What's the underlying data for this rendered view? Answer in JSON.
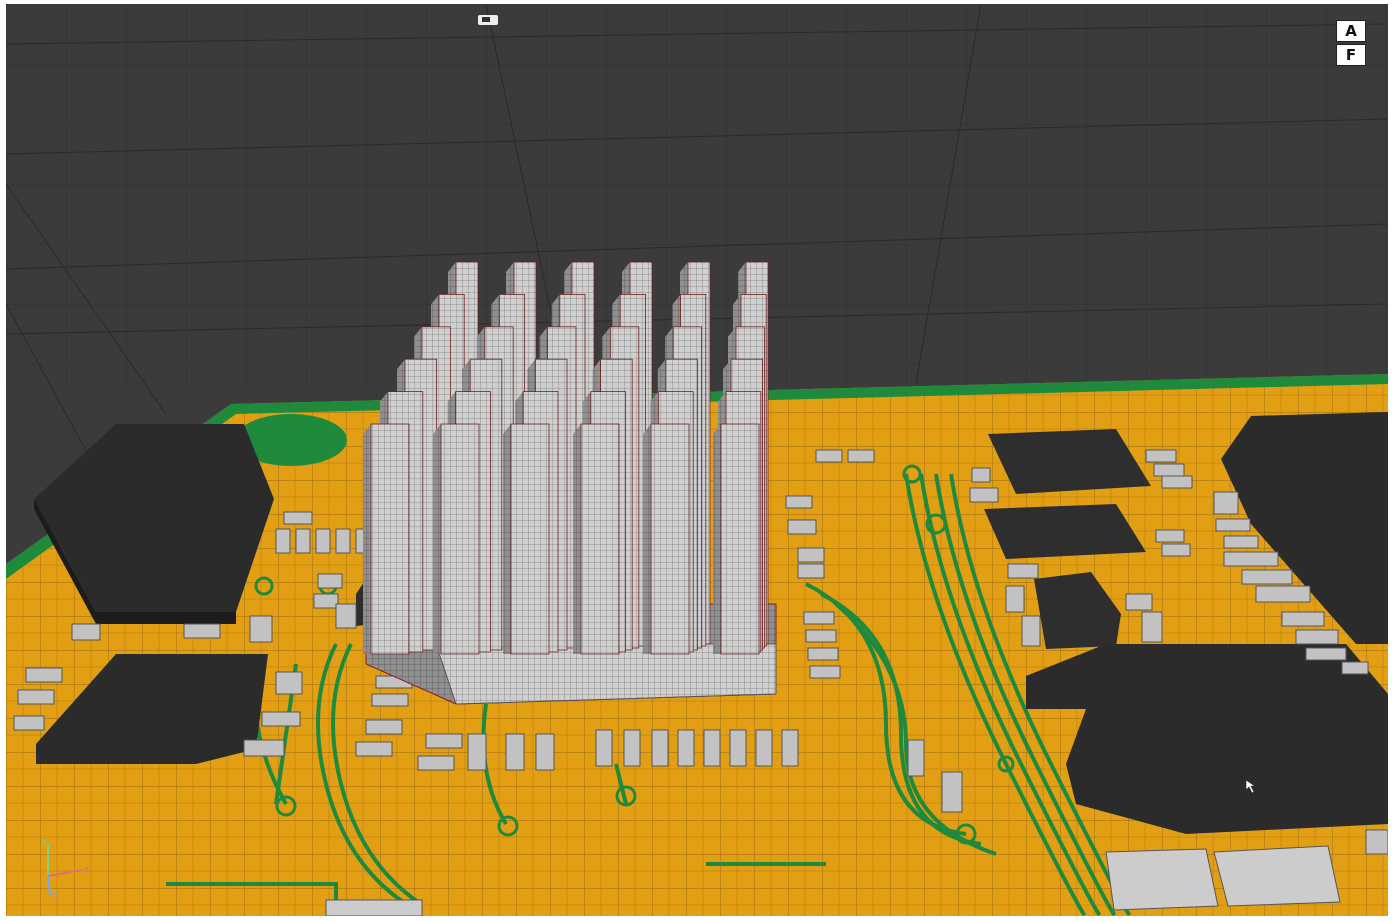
{
  "view_cube": {
    "top_label": "A",
    "bottom_label": "F"
  },
  "icons": {
    "camera": "camera-marker-icon",
    "triad": "axis-triad-icon",
    "cursor": "mouse-pointer-icon"
  },
  "colors": {
    "background": "#3a3a3a",
    "board": "#e39f14",
    "traces": "#1f8a3c",
    "components": "#2e2e2e",
    "heatsink": "#c8c8c8",
    "passives": "#bdbdbd",
    "mesh_lines": "#1a1a1a"
  }
}
